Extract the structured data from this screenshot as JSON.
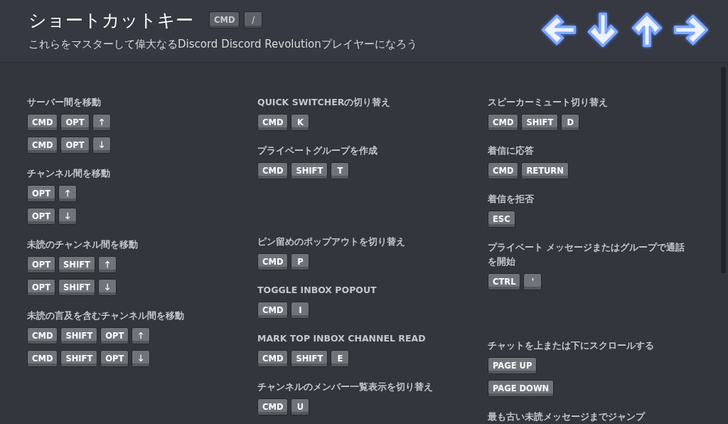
{
  "header": {
    "title": "ショートカットキー",
    "title_keys": [
      "CMD",
      "/"
    ],
    "subtitle": "これらをマスターして偉大なるDiscord Discord Revolutionプレイヤーになろう"
  },
  "columns": [
    [
      {
        "label": "サーバー間を移動",
        "combos": [
          [
            "CMD",
            "OPT",
            "🡑"
          ],
          [
            "CMD",
            "OPT",
            "🡓"
          ]
        ]
      },
      {
        "label": "チャンネル間を移動",
        "combos": [
          [
            "OPT",
            "🡑"
          ],
          [
            "OPT",
            "🡓"
          ]
        ]
      },
      {
        "label": "未読のチャンネル間を移動",
        "combos": [
          [
            "OPT",
            "SHIFT",
            "🡑"
          ],
          [
            "OPT",
            "SHIFT",
            "🡓"
          ]
        ]
      },
      {
        "label": "未読の言及を含むチャンネル間を移動",
        "combos": [
          [
            "CMD",
            "SHIFT",
            "OPT",
            "🡑"
          ],
          [
            "CMD",
            "SHIFT",
            "OPT",
            "🡓"
          ]
        ]
      }
    ],
    [
      {
        "label": "QUICK SWITCHERの切り替え",
        "combos": [
          [
            "CMD",
            "K"
          ]
        ]
      },
      {
        "label": "プライベートグループを作成",
        "combos": [
          [
            "CMD",
            "SHIFT",
            "T"
          ]
        ]
      },
      {
        "label": "ピン留めのポップアウトを切り替え",
        "combos": [
          [
            "CMD",
            "P"
          ]
        ]
      },
      {
        "label": "TOGGLE INBOX POPOUT",
        "combos": [
          [
            "CMD",
            "I"
          ]
        ]
      },
      {
        "label": "MARK TOP INBOX CHANNEL READ",
        "combos": [
          [
            "CMD",
            "SHIFT",
            "E"
          ]
        ]
      },
      {
        "label": "チャンネルのメンバー一覧表示を切り替え",
        "combos": [
          [
            "CMD",
            "U"
          ]
        ]
      }
    ],
    [
      {
        "label": "スピーカーミュート切り替え",
        "combos": [
          [
            "CMD",
            "SHIFT",
            "D"
          ]
        ]
      },
      {
        "label": "着信に応答",
        "combos": [
          [
            "CMD",
            "RETURN"
          ]
        ]
      },
      {
        "label": "着信を拒否",
        "combos": [
          [
            "ESC"
          ]
        ]
      },
      {
        "label": "プライベート メッセージまたはグループで通話を開始",
        "combos": [
          [
            "CTRL",
            "'"
          ]
        ]
      },
      {
        "label": "チャットを上または下にスクロールする",
        "combos": [
          [
            "PAGE UP"
          ],
          [
            "PAGE DOWN"
          ]
        ]
      },
      {
        "label": "最も古い未読メッセージまでジャンプ"
      }
    ]
  ]
}
